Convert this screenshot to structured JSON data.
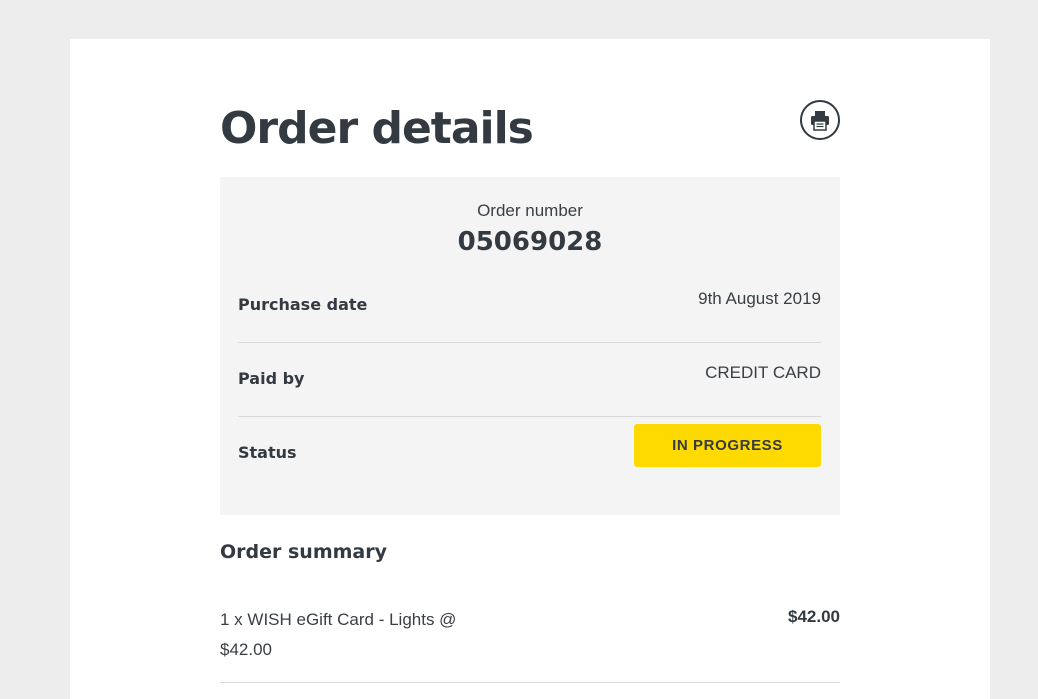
{
  "page": {
    "title": "Order details",
    "print_icon": "printer-icon"
  },
  "order": {
    "number_label": "Order number",
    "number": "05069028",
    "rows": {
      "purchase_date": {
        "label": "Purchase date",
        "value": "9th August 2019"
      },
      "paid_by": {
        "label": "Paid by",
        "value": "CREDIT CARD"
      },
      "status": {
        "label": "Status",
        "value": "IN PROGRESS"
      }
    },
    "status_color": "#ffda00"
  },
  "summary": {
    "title": "Order summary",
    "items": [
      {
        "description": "1 x WISH eGift Card - Lights @ $42.00",
        "price": "$42.00"
      }
    ]
  }
}
